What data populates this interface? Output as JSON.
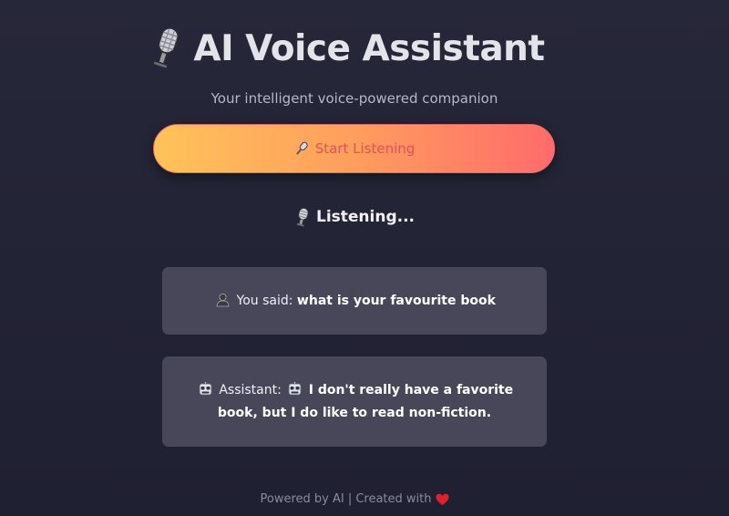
{
  "header": {
    "title": "AI Voice Assistant",
    "title_icon": "studio-microphone-icon",
    "subtitle": "Your intelligent voice-powered companion"
  },
  "listen_button": {
    "label": "Start Listening",
    "icon": "microphone-icon"
  },
  "status": {
    "text": "Listening...",
    "icon": "studio-microphone-icon"
  },
  "conversation": {
    "user": {
      "icon": "bust-in-silhouette-icon",
      "prefix": "You said:",
      "text": "what is your favourite book"
    },
    "assistant": {
      "icon": "robot-face-icon",
      "prefix": "Assistant:",
      "text": "I don't really have a favorite book, but I do like to read non-fiction."
    }
  },
  "footer": {
    "text": "Powered by AI | Created with",
    "icon": "heart-icon"
  },
  "colors": {
    "background": "#262739",
    "card": "#48475a",
    "button_gradient_start": "#ffc35a",
    "button_gradient_end": "#ff6b6b",
    "button_text": "#e2505a"
  }
}
